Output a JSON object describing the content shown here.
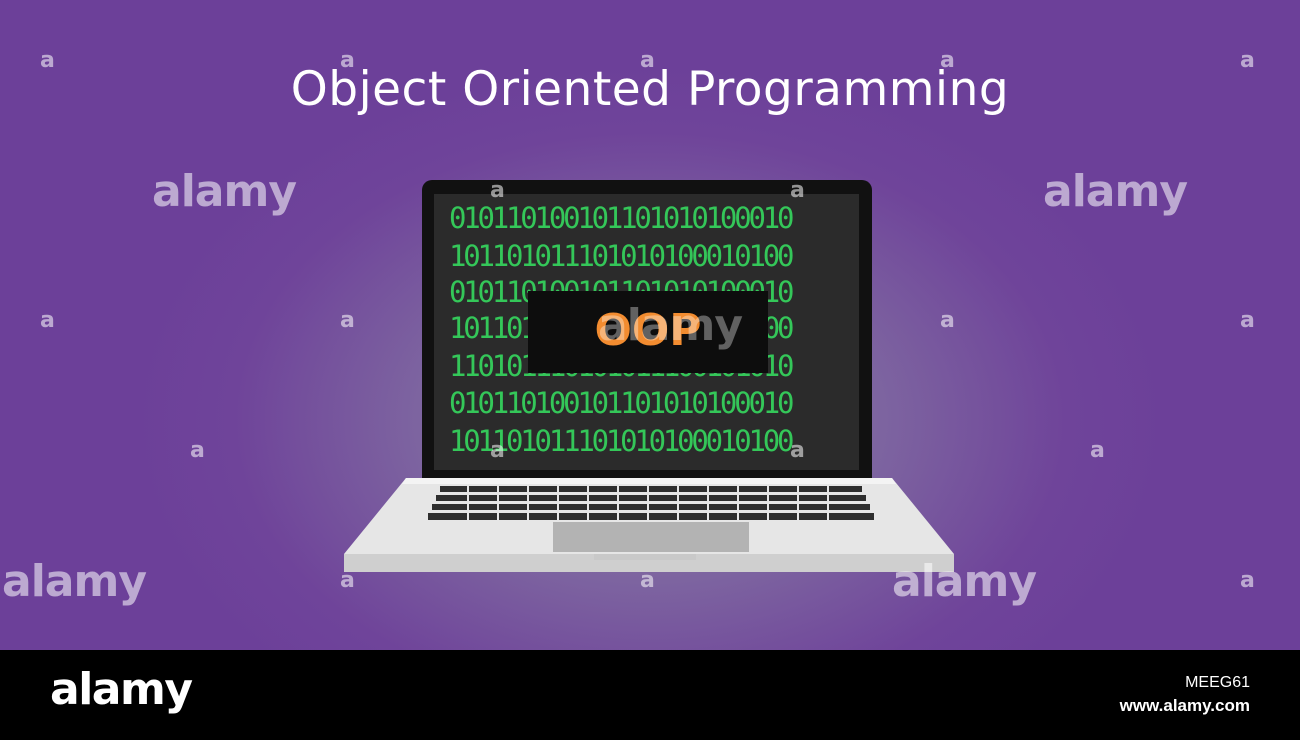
{
  "title": "Object Oriented Programming",
  "screen": {
    "binary_lines": [
      "010110100101101010100010",
      "101101011101010100010100",
      "010110100101101010100010",
      "101101011101010100010100",
      "110101110101011100101010",
      "010110100101101010100010",
      "101101011101010100010100"
    ],
    "badge": "OOP"
  },
  "watermark": {
    "brand": "alamy",
    "letter": "a"
  },
  "footer": {
    "logo": "alamy",
    "image_id": "MEEG61",
    "url": "www.alamy.com"
  },
  "colors": {
    "background": "#6c4099",
    "binary": "#34c759",
    "badge_text": "#f28c30"
  }
}
